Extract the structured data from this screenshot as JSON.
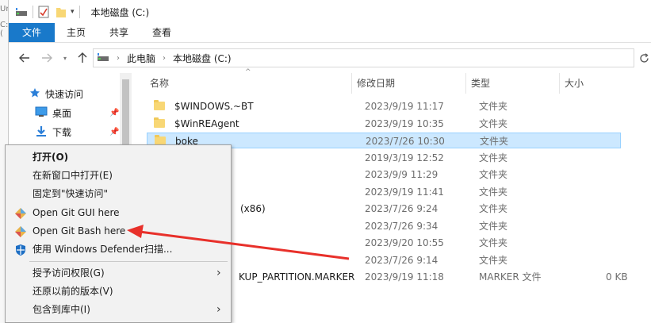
{
  "window": {
    "title": "本地磁盘 (C:)"
  },
  "left_strip": {
    "frag1": "Ur",
    "frag2": "C:("
  },
  "ribbon": {
    "tabs": [
      "文件",
      "主页",
      "共享",
      "查看"
    ]
  },
  "nav": {
    "breadcrumbs": [
      "此电脑",
      "本地磁盘 (C:)"
    ]
  },
  "sidebar": {
    "items": [
      {
        "label": "快速访问",
        "icon": "star-icon"
      },
      {
        "label": "桌面",
        "icon": "desktop-icon",
        "pinned": true
      },
      {
        "label": "下载",
        "icon": "download-icon",
        "pinned": true
      }
    ]
  },
  "columns": {
    "name": "名称",
    "date": "修改日期",
    "type": "类型",
    "size": "大小"
  },
  "files": [
    {
      "name": "$WINDOWS.~BT",
      "date": "2023/9/19 11:17",
      "type": "文件夹",
      "size": ""
    },
    {
      "name": "$WinREAgent",
      "date": "2023/9/19 10:35",
      "type": "文件夹",
      "size": ""
    },
    {
      "name": "boke",
      "date": "2023/7/26 10:30",
      "type": "文件夹",
      "size": "",
      "selected": true
    },
    {
      "name": "",
      "date": "2019/3/19 12:52",
      "type": "文件夹",
      "size": ""
    },
    {
      "name": "",
      "date": "2023/9/9 11:29",
      "type": "文件夹",
      "size": ""
    },
    {
      "name": "",
      "date": "2023/9/19 11:41",
      "type": "文件夹",
      "size": ""
    },
    {
      "name": "(x86)",
      "date": "2023/7/26 9:24",
      "type": "文件夹",
      "size": ""
    },
    {
      "name": "",
      "date": "2023/7/26 9:34",
      "type": "文件夹",
      "size": ""
    },
    {
      "name": "",
      "date": "2023/9/20 10:55",
      "type": "文件夹",
      "size": ""
    },
    {
      "name": "",
      "date": "2023/7/26 9:14",
      "type": "文件夹",
      "size": ""
    },
    {
      "name": "KUP_PARTITION.MARKER",
      "date": "2023/9/19 11:18",
      "type": "MARKER 文件",
      "size": "0 KB"
    }
  ],
  "context_menu": {
    "items": [
      {
        "label": "打开(O)",
        "bold": true
      },
      {
        "label": "在新窗口中打开(E)"
      },
      {
        "label": "固定到\"快速访问\""
      },
      {
        "label": "Open Git GUI here",
        "icon": "git-gui-icon"
      },
      {
        "label": "Open Git Bash here",
        "icon": "git-bash-icon"
      },
      {
        "label": "使用 Windows Defender扫描...",
        "icon": "windows-defender-icon"
      },
      {
        "label": "授予访问权限(G)",
        "submenu": true
      },
      {
        "label": "还原以前的版本(V)"
      },
      {
        "label": "包含到库中(I)",
        "submenu": true
      }
    ]
  },
  "colors": {
    "accent": "#1979ca",
    "selection": "#cce8ff",
    "selection_border": "#99d1ff",
    "annotation": "#e8302a"
  }
}
